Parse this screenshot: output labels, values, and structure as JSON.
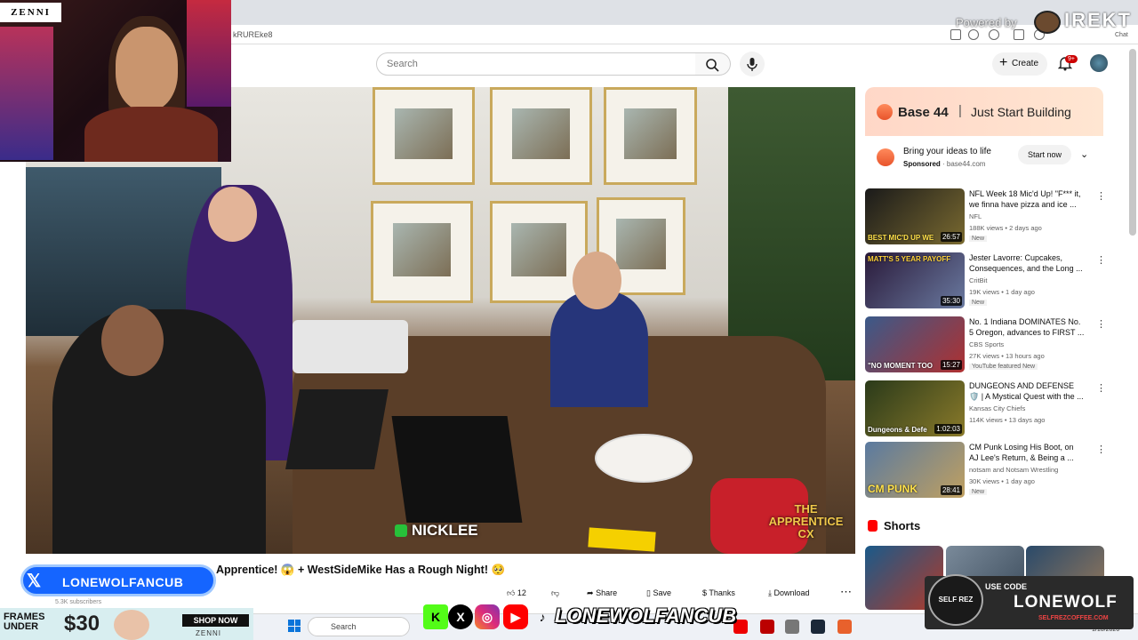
{
  "browser": {
    "url_fragment": "kRUREke8",
    "chat_label": "Chat"
  },
  "header": {
    "search_placeholder": "Search",
    "create_label": "Create",
    "notif_count": "9+"
  },
  "video": {
    "caption": "NICKLEE",
    "show_logo": "THE APPRENTICE CX",
    "title": "Apprentice! 😱 + WestSideMike Has a Rough Night! 🥺",
    "subscribers": "5.3K subscribers",
    "actions": {
      "likes": "12",
      "share": "Share",
      "save": "Save",
      "thanks": "Thanks",
      "download": "Download"
    }
  },
  "ad": {
    "brand": "Base 44",
    "tagline": "Just Start Building",
    "headline": "Bring your ideas to life",
    "sponsored": "Sponsored",
    "domain": "base44.com",
    "cta": "Start now"
  },
  "recommendations": [
    {
      "title": "NFL Week 18 Mic'd Up! \"F*** it, we finna have pizza and ice ...",
      "channel": "NFL",
      "meta": "188K views • 2 days ago",
      "badge": "New",
      "duration": "26:57",
      "thumb_text": "BEST MIC'D UP WE"
    },
    {
      "title": "Jester Lavorre: Cupcakes, Consequences, and the Long ...",
      "channel": "CritBit",
      "meta": "19K views • 1 day ago",
      "badge": "New",
      "duration": "35:30",
      "thumb_text": "MATT'S 5 YEAR PAYOFF"
    },
    {
      "title": "No. 1 Indiana DOMINATES No. 5 Oregon, advances to FIRST ...",
      "channel": "CBS Sports",
      "meta": "27K views • 13 hours ago",
      "badge": "YouTube featured  New",
      "duration": "15:27",
      "thumb_text": "\"NO MOMENT TOO"
    },
    {
      "title": "DUNGEONS AND DEFENSE 🛡️ | A Mystical Quest with the ...",
      "channel": "Kansas City Chiefs",
      "meta": "114K views • 13 days ago",
      "badge": "",
      "duration": "1:02:03",
      "thumb_text": "Dungeons & Defe"
    },
    {
      "title": "CM Punk Losing His Boot, on AJ Lee's Return, & Being a ...",
      "channel": "notsam  and Notsam Wrestling",
      "meta": "30K views • 1 day ago",
      "badge": "New",
      "duration": "28:41",
      "thumb_text": "CM PUNK"
    }
  ],
  "shorts": {
    "title": "Shorts"
  },
  "stream": {
    "zenni_logo": "ZENNI",
    "username_badge": "LONEWOLFANCUB",
    "social_name": "LONEWOLFANCUB",
    "frames_line1": "FRAMES",
    "frames_line2": "UNDER",
    "frames_price": "30",
    "shop_now": "SHOP NOW",
    "zenni_small": "ZENNI",
    "promo_use": "USE CODE",
    "promo_code": "LONEWOLF",
    "promo_url": "SELFREZCOFFEE.COM",
    "promo_badge": "SELF REZ",
    "powered_by": "Powered by",
    "brand": "IREKT"
  },
  "taskbar": {
    "search": "Search",
    "date": "1/10/2026"
  },
  "colors": {
    "accent_red": "#cc0000",
    "badge_blue": "#1565ff"
  }
}
